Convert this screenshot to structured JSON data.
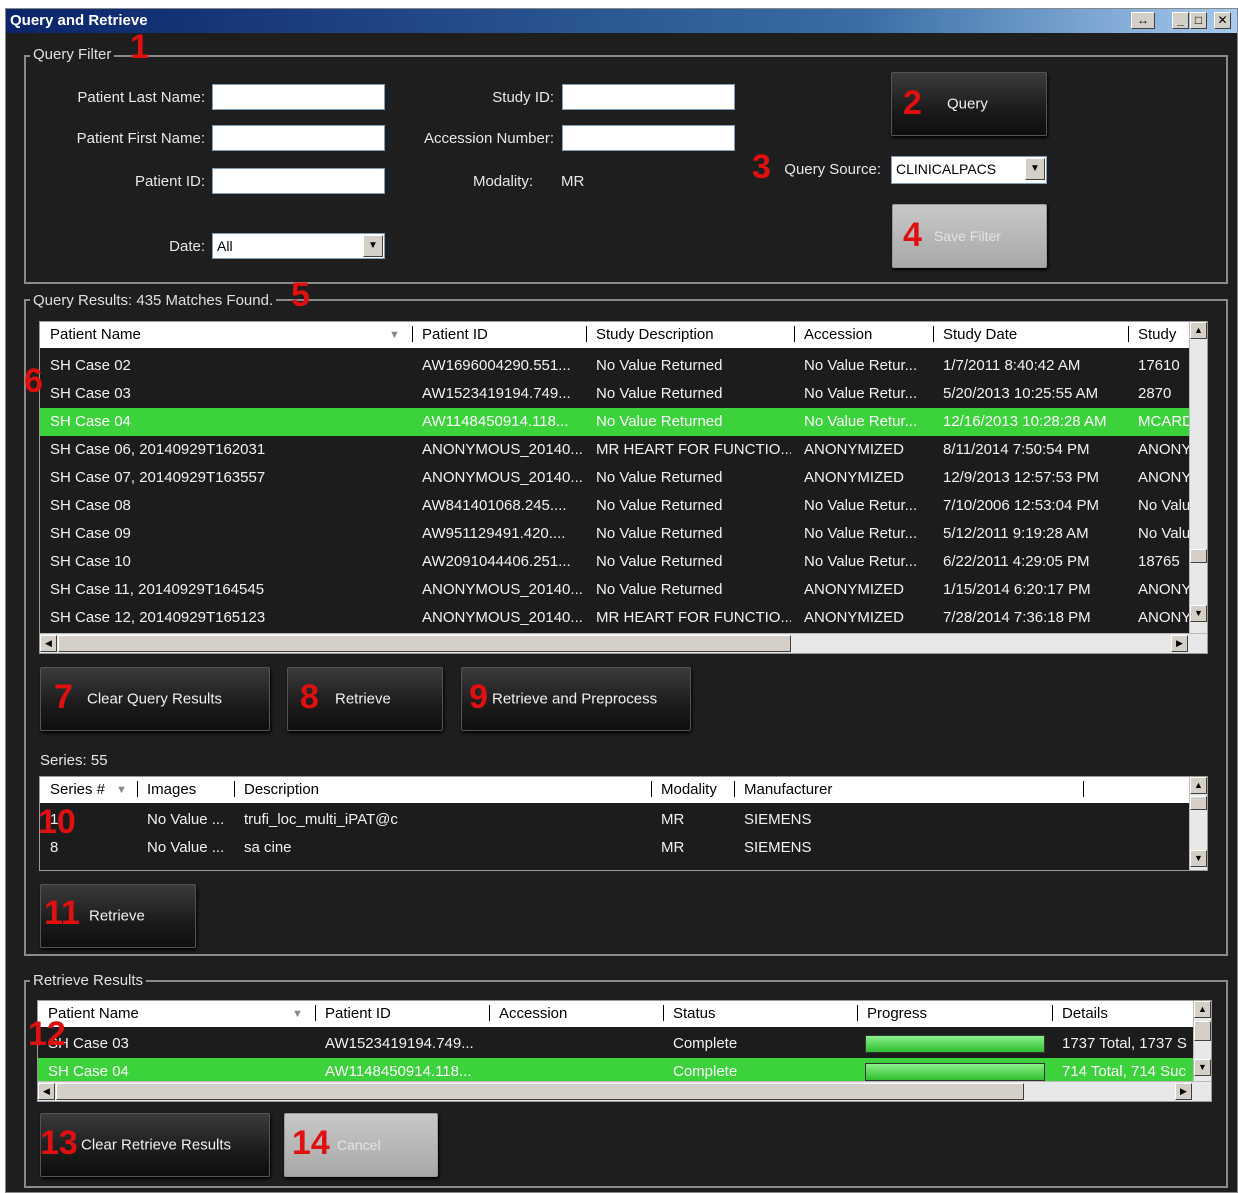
{
  "window": {
    "title": "Query and Retrieve",
    "controls": [
      "↔",
      "_",
      "□",
      "✕"
    ]
  },
  "callouts": [
    "1",
    "2",
    "3",
    "4",
    "5",
    "6",
    "7",
    "8",
    "9",
    "10",
    "11",
    "12",
    "13",
    "14"
  ],
  "query_filter": {
    "legend": "Query Filter",
    "patient_last_name_label": "Patient Last Name:",
    "patient_first_name_label": "Patient First Name:",
    "patient_id_label": "Patient ID:",
    "date_label": "Date:",
    "date_value": "All",
    "study_id_label": "Study ID:",
    "accession_label": "Accession Number:",
    "modality_label": "Modality:",
    "modality_value": "MR",
    "query_button": "Query",
    "query_source_label": "Query Source:",
    "query_source_value": "CLINICALPACS",
    "save_filter_button": "Save Filter"
  },
  "query_results": {
    "legend": "Query Results: 435 Matches Found.",
    "columns": [
      "Patient Name",
      "Patient ID",
      "Study Description",
      "Accession",
      "Study Date",
      "Study"
    ],
    "rows": [
      {
        "name": "SH Case 02",
        "id": "AW1696004290.551...",
        "desc": "No Value Returned",
        "acc": "No Value Retur...",
        "date": "1/7/2011 8:40:42 AM",
        "study": "17610",
        "selected": false
      },
      {
        "name": "SH Case 03",
        "id": "AW1523419194.749...",
        "desc": "No Value Returned",
        "acc": "No Value Retur...",
        "date": "5/20/2013 10:25:55 AM",
        "study": "2870",
        "selected": false
      },
      {
        "name": "SH Case 04",
        "id": "AW1148450914.118...",
        "desc": "No Value Returned",
        "acc": "No Value Retur...",
        "date": "12/16/2013 10:28:28 AM",
        "study": "MCARD",
        "selected": true
      },
      {
        "name": "SH Case 06, 20140929T162031",
        "id": "ANONYMOUS_20140...",
        "desc": "MR HEART FOR FUNCTIO...",
        "acc": "ANONYMIZED",
        "date": "8/11/2014 7:50:54 PM",
        "study": "ANONY",
        "selected": false
      },
      {
        "name": "SH Case 07, 20140929T163557",
        "id": "ANONYMOUS_20140...",
        "desc": "No Value Returned",
        "acc": "ANONYMIZED",
        "date": "12/9/2013 12:57:53 PM",
        "study": "ANONY",
        "selected": false
      },
      {
        "name": "SH Case 08",
        "id": "AW841401068.245....",
        "desc": "No Value Returned",
        "acc": "No Value Retur...",
        "date": "7/10/2006 12:53:04 PM",
        "study": "No Valu",
        "selected": false
      },
      {
        "name": "SH Case 09",
        "id": "AW951129491.420....",
        "desc": "No Value Returned",
        "acc": "No Value Retur...",
        "date": "5/12/2011 9:19:28 AM",
        "study": "No Valu",
        "selected": false
      },
      {
        "name": "SH Case 10",
        "id": "AW2091044406.251...",
        "desc": "No Value Returned",
        "acc": "No Value Retur...",
        "date": "6/22/2011 4:29:05 PM",
        "study": "18765",
        "selected": false
      },
      {
        "name": "SH Case 11, 20140929T164545",
        "id": "ANONYMOUS_20140...",
        "desc": "No Value Returned",
        "acc": "ANONYMIZED",
        "date": "1/15/2014 6:20:17 PM",
        "study": "ANONY",
        "selected": false
      },
      {
        "name": "SH Case 12, 20140929T165123",
        "id": "ANONYMOUS_20140...",
        "desc": "MR HEART FOR FUNCTIO...",
        "acc": "ANONYMIZED",
        "date": "7/28/2014 7:36:18 PM",
        "study": "ANONY",
        "selected": false
      }
    ],
    "clear_button": "Clear Query Results",
    "retrieve_button": "Retrieve",
    "retrieve_preprocess_button": "Retrieve and Preprocess"
  },
  "series": {
    "label": "Series: 55",
    "columns": [
      "Series #",
      "Images",
      "Description",
      "Modality",
      "Manufacturer"
    ],
    "rows": [
      {
        "num": "1",
        "images": "No Value ...",
        "desc": "trufi_loc_multi_iPAT@c",
        "modality": "MR",
        "manufacturer": "SIEMENS"
      },
      {
        "num": "8",
        "images": "No Value ...",
        "desc": "sa cine",
        "modality": "MR",
        "manufacturer": "SIEMENS"
      }
    ],
    "retrieve_button": "Retrieve"
  },
  "retrieve_results": {
    "legend": "Retrieve Results",
    "columns": [
      "Patient Name",
      "Patient ID",
      "Accession",
      "Status",
      "Progress",
      "Details"
    ],
    "rows": [
      {
        "name": "SH Case 03",
        "id": "AW1523419194.749...",
        "acc": "",
        "status": "Complete",
        "progress": 1.0,
        "details": "1737 Total, 1737 S",
        "selected": false
      },
      {
        "name": "SH Case 04",
        "id": "AW1148450914.118...",
        "acc": "",
        "status": "Complete",
        "progress": 1.0,
        "details": "714 Total, 714 Suc",
        "selected": true
      }
    ],
    "clear_button": "Clear Retrieve Results",
    "cancel_button": "Cancel"
  },
  "colors": {
    "selected_row": "#3cd23c",
    "callout": "#e01010",
    "background": "#1e1e1e"
  }
}
